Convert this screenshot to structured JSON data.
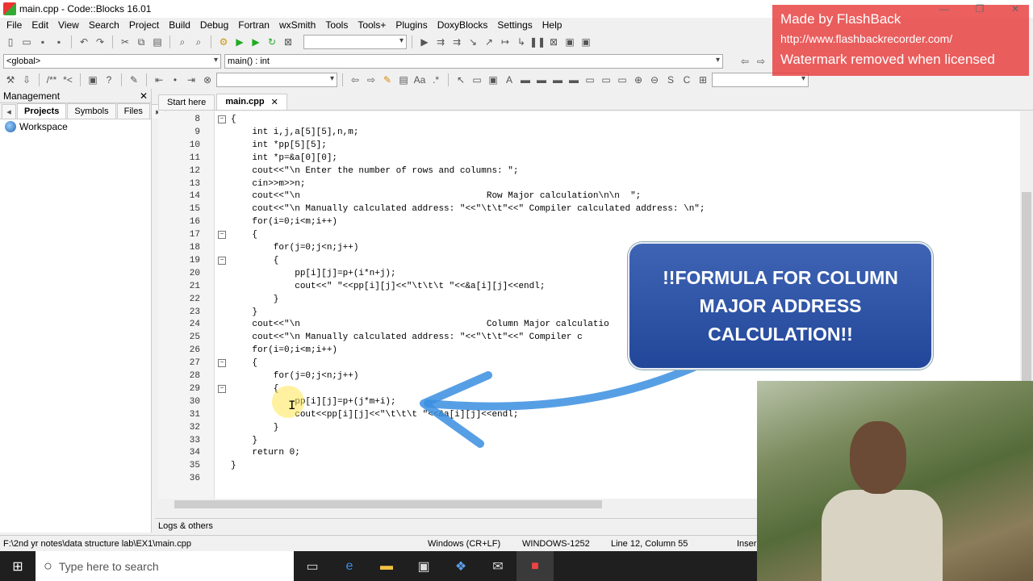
{
  "window": {
    "title": "main.cpp - Code::Blocks 16.01"
  },
  "menu": [
    "File",
    "Edit",
    "View",
    "Search",
    "Project",
    "Build",
    "Debug",
    "Fortran",
    "wxSmith",
    "Tools",
    "Tools+",
    "Plugins",
    "DoxyBlocks",
    "Settings",
    "Help"
  ],
  "scope": {
    "global": "<global>",
    "function": "main() : int"
  },
  "management": {
    "title": "Management",
    "tabs": [
      "Projects",
      "Symbols",
      "Files"
    ],
    "workspace": "Workspace"
  },
  "editor_tabs": [
    "Start here",
    "main.cpp"
  ],
  "code_lines": [
    {
      "n": "8",
      "t": "{"
    },
    {
      "n": "9",
      "t": "    int i,j,a[5][5],n,m;"
    },
    {
      "n": "10",
      "t": "    int *pp[5][5];"
    },
    {
      "n": "11",
      "t": "    int *p=&a[0][0];"
    },
    {
      "n": "12",
      "t": "    cout<<\"\\n Enter the number of rows and columns: \";"
    },
    {
      "n": "13",
      "t": "    cin>>m>>n;"
    },
    {
      "n": "14",
      "t": "    cout<<\"\\n                                   Row Major calculation\\n\\n  \";"
    },
    {
      "n": "15",
      "t": "    cout<<\"\\n Manually calculated address: \"<<\"\\t\\t\"<<\" Compiler calculated address: \\n\";"
    },
    {
      "n": "16",
      "t": "    for(i=0;i<m;i++)"
    },
    {
      "n": "17",
      "t": "    {"
    },
    {
      "n": "18",
      "t": "        for(j=0;j<n;j++)"
    },
    {
      "n": "19",
      "t": "        {"
    },
    {
      "n": "20",
      "t": "            pp[i][j]=p+(i*n+j);"
    },
    {
      "n": "21",
      "t": "            cout<<\" \"<<pp[i][j]<<\"\\t\\t\\t \"<<&a[i][j]<<endl;"
    },
    {
      "n": "22",
      "t": "        }"
    },
    {
      "n": "23",
      "t": "    }"
    },
    {
      "n": "24",
      "t": "    cout<<\"\\n                                   Column Major calculatio"
    },
    {
      "n": "25",
      "t": "    cout<<\"\\n Manually calculated address: \"<<\"\\t\\t\"<<\" Compiler c"
    },
    {
      "n": "26",
      "t": "    for(i=0;i<m;i++)"
    },
    {
      "n": "27",
      "t": "    {"
    },
    {
      "n": "28",
      "t": "        for(j=0;j<n;j++)"
    },
    {
      "n": "29",
      "t": "        {"
    },
    {
      "n": "30",
      "t": "            pp[i][j]=p+(j*m+i);"
    },
    {
      "n": "31",
      "t": "            cout<<pp[i][j]<<\"\\t\\t\\t \"<<&a[i][j]<<endl;"
    },
    {
      "n": "32",
      "t": "        }"
    },
    {
      "n": "33",
      "t": "    }"
    },
    {
      "n": "34",
      "t": "    return 0;"
    },
    {
      "n": "35",
      "t": "}"
    },
    {
      "n": "36",
      "t": ""
    }
  ],
  "logs": "Logs & others",
  "status": {
    "path": "F:\\2nd yr notes\\data structure lab\\EX1\\main.cpp",
    "eol": "Windows (CR+LF)",
    "encoding": "WINDOWS-1252",
    "position": "Line 12, Column 55",
    "mode": "Inser"
  },
  "taskbar": {
    "search_placeholder": "Type here to search"
  },
  "watermark": {
    "line1": "Made by FlashBack",
    "line2": "http://www.flashbackrecorder.com/",
    "line3": "Watermark removed when licensed"
  },
  "callout": "!!FORMULA FOR COLUMN MAJOR ADDRESS CALCULATION!!"
}
